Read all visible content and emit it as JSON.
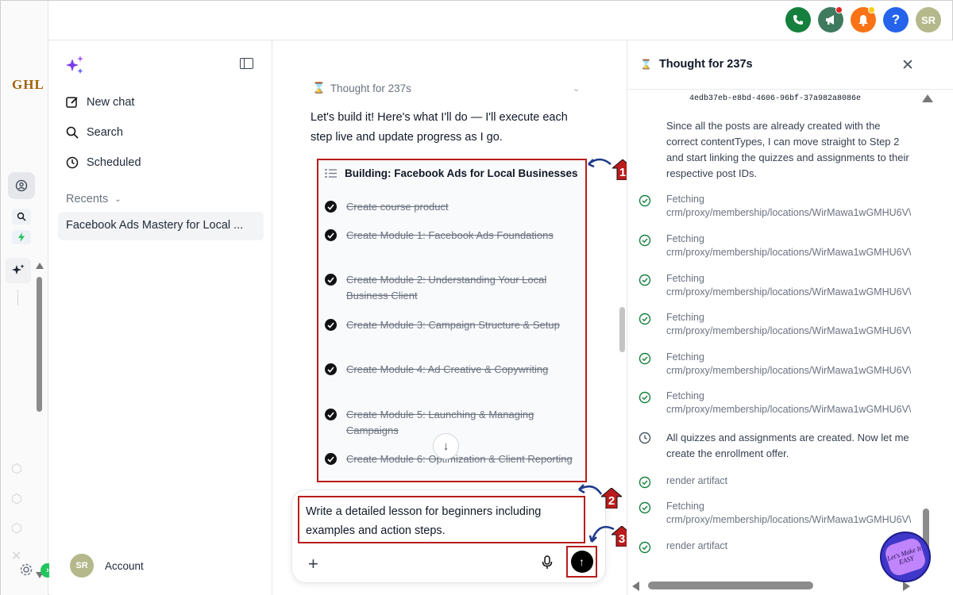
{
  "app": {
    "brand": "GHL"
  },
  "topbar": {
    "icons": [
      "phone-icon",
      "megaphone-icon",
      "bell-icon",
      "help-icon"
    ],
    "avatar_initials": "SR"
  },
  "sidebar": {
    "new_chat": "New chat",
    "search": "Search",
    "scheduled": "Scheduled",
    "recents_label": "Recents",
    "recent_items": [
      "Facebook Ads Mastery for Local ..."
    ],
    "account_initials": "SR",
    "account_label": "Account"
  },
  "chat": {
    "thought_label": "Thought for 237s",
    "message": "Let's build it! Here's what I'll do — I'll execute each step live and update progress as I go.",
    "plan": {
      "title": "Building: Facebook Ads for Local Businesses",
      "steps": [
        "Create course product",
        "Create Module 1: Facebook Ads Foundations",
        "Create Module 2: Understanding Your Local Business Client",
        "Create Module 3: Campaign Structure & Setup",
        "Create Module 4: Ad Creative & Copywriting",
        "Create Module 5: Launching & Managing Campaigns",
        "Create Module 6: Optimization & Client Reporting"
      ]
    },
    "composer_text": "Write a detailed lesson for beginners including examples and action steps.",
    "annotations": [
      "1",
      "2",
      "3"
    ]
  },
  "thought_panel": {
    "title": "Thought for 237s",
    "hash": "4edb37eb-e8bd-4606-96bf-37a982a8086e",
    "paragraph": "Since all the posts are already created with the correct contentTypes, I can move straight to Step 2 and start linking the quizzes and assignments to their respective post IDs.",
    "items": [
      {
        "kind": "done",
        "label": "Fetching",
        "detail": "crm/proxy/membership/locations/WirMawa1wGMHU6V\\"
      },
      {
        "kind": "done",
        "label": "Fetching",
        "detail": "crm/proxy/membership/locations/WirMawa1wGMHU6V\\"
      },
      {
        "kind": "done",
        "label": "Fetching",
        "detail": "crm/proxy/membership/locations/WirMawa1wGMHU6V\\"
      },
      {
        "kind": "done",
        "label": "Fetching",
        "detail": "crm/proxy/membership/locations/WirMawa1wGMHU6V\\"
      },
      {
        "kind": "done",
        "label": "Fetching",
        "detail": "crm/proxy/membership/locations/WirMawa1wGMHU6V\\"
      },
      {
        "kind": "done",
        "label": "Fetching",
        "detail": "crm/proxy/membership/locations/WirMawa1wGMHU6V\\"
      },
      {
        "kind": "clock",
        "label": "All quizzes and assignments are created. Now let me create the enrollment offer.",
        "detail": ""
      },
      {
        "kind": "done",
        "label": "render artifact",
        "detail": ""
      },
      {
        "kind": "done",
        "label": "Fetching",
        "detail": "crm/proxy/membership/locations/WirMawa1wGMHU6V\\"
      },
      {
        "kind": "done",
        "label": "render artifact",
        "detail": ""
      }
    ]
  },
  "badge": {
    "text": "Let's Make It EASY"
  },
  "colors": {
    "annotation_red": "#b91c1c",
    "check_green": "#15803d",
    "brand_gold": "#a16207"
  }
}
